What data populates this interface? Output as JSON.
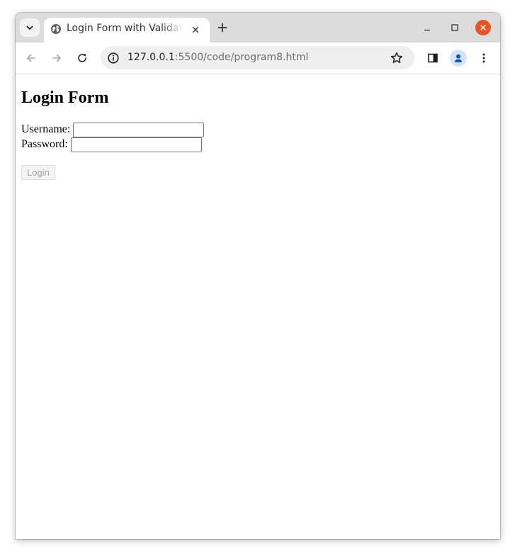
{
  "browser": {
    "tab": {
      "title": "Login Form with Validation",
      "favicon": "globe-icon",
      "close_icon": "close-icon"
    },
    "tab_search_icon": "chevron-down-icon",
    "new_tab_icon": "plus-icon",
    "window_controls": {
      "minimize": "minimize-icon",
      "maximize": "maximize-icon",
      "close": "window-close-icon",
      "close_color": "#e95420"
    },
    "toolbar": {
      "back_icon": "arrow-left-icon",
      "forward_icon": "arrow-right-icon",
      "reload_icon": "reload-icon",
      "site_info_icon": "info-icon",
      "url_host": "127.0.0.1",
      "url_rest": ":5500/code/program8.html",
      "bookmark_icon": "star-icon",
      "side_panel_icon": "side-panel-icon",
      "profile_icon": "profile-avatar-icon",
      "menu_icon": "kebab-menu-icon"
    }
  },
  "page": {
    "heading": "Login Form",
    "form": {
      "username_label": "Username:",
      "username_value": "",
      "password_label": "Password:",
      "password_value": "",
      "submit_label": "Login",
      "submit_disabled": true
    }
  }
}
